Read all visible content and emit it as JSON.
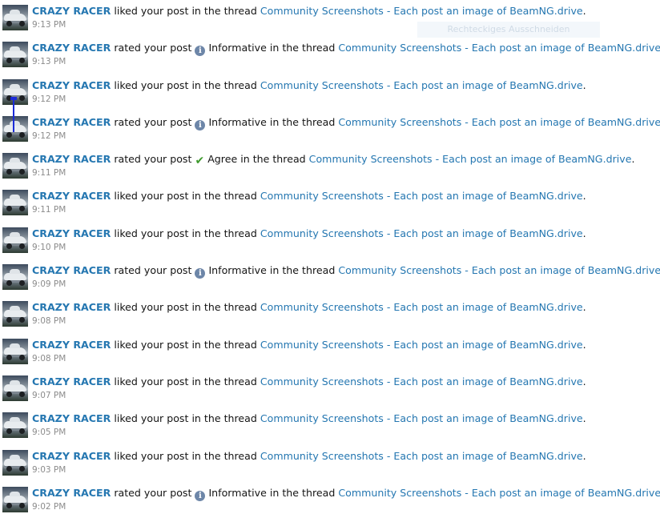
{
  "overlay": {
    "tooltip_text": "Rechteckiges Ausschneiden"
  },
  "alerts": [
    {
      "user": "CRAZY RACER",
      "action": "liked your post in the thread",
      "rating": "",
      "rating_icon": "",
      "suffix": "",
      "thread": "Community Screenshots - Each post an image of BeamNG.drive",
      "time": "9:13 PM"
    },
    {
      "user": "CRAZY RACER",
      "action": "rated your post",
      "rating": "Informative",
      "rating_icon": "info-icon",
      "suffix": "in the thread",
      "thread": "Community Screenshots - Each post an image of BeamNG.drive",
      "time": "9:13 PM"
    },
    {
      "user": "CRAZY RACER",
      "action": "liked your post in the thread",
      "rating": "",
      "rating_icon": "",
      "suffix": "",
      "thread": "Community Screenshots - Each post an image of BeamNG.drive",
      "time": "9:12 PM"
    },
    {
      "user": "CRAZY RACER",
      "action": "rated your post",
      "rating": "Informative",
      "rating_icon": "info-icon",
      "suffix": "in the thread",
      "thread": "Community Screenshots - Each post an image of BeamNG.drive",
      "time": "9:12 PM"
    },
    {
      "user": "CRAZY RACER",
      "action": "rated your post",
      "rating": "Agree",
      "rating_icon": "check-icon",
      "suffix": "in the thread",
      "thread": "Community Screenshots - Each post an image of BeamNG.drive",
      "time": "9:11 PM"
    },
    {
      "user": "CRAZY RACER",
      "action": "liked your post in the thread",
      "rating": "",
      "rating_icon": "",
      "suffix": "",
      "thread": "Community Screenshots - Each post an image of BeamNG.drive",
      "time": "9:11 PM"
    },
    {
      "user": "CRAZY RACER",
      "action": "liked your post in the thread",
      "rating": "",
      "rating_icon": "",
      "suffix": "",
      "thread": "Community Screenshots - Each post an image of BeamNG.drive",
      "time": "9:10 PM"
    },
    {
      "user": "CRAZY RACER",
      "action": "rated your post",
      "rating": "Informative",
      "rating_icon": "info-icon",
      "suffix": "in the thread",
      "thread": "Community Screenshots - Each post an image of BeamNG.drive",
      "time": "9:09 PM"
    },
    {
      "user": "CRAZY RACER",
      "action": "liked your post in the thread",
      "rating": "",
      "rating_icon": "",
      "suffix": "",
      "thread": "Community Screenshots - Each post an image of BeamNG.drive",
      "time": "9:08 PM"
    },
    {
      "user": "CRAZY RACER",
      "action": "liked your post in the thread",
      "rating": "",
      "rating_icon": "",
      "suffix": "",
      "thread": "Community Screenshots - Each post an image of BeamNG.drive",
      "time": "9:08 PM"
    },
    {
      "user": "CRAZY RACER",
      "action": "liked your post in the thread",
      "rating": "",
      "rating_icon": "",
      "suffix": "",
      "thread": "Community Screenshots - Each post an image of BeamNG.drive",
      "time": "9:07 PM"
    },
    {
      "user": "CRAZY RACER",
      "action": "liked your post in the thread",
      "rating": "",
      "rating_icon": "",
      "suffix": "",
      "thread": "Community Screenshots - Each post an image of BeamNG.drive",
      "time": "9:05 PM"
    },
    {
      "user": "CRAZY RACER",
      "action": "liked your post in the thread",
      "rating": "",
      "rating_icon": "",
      "suffix": "",
      "thread": "Community Screenshots - Each post an image of BeamNG.drive",
      "time": "9:03 PM"
    },
    {
      "user": "CRAZY RACER",
      "action": "rated your post",
      "rating": "Informative",
      "rating_icon": "info-icon",
      "suffix": "in the thread",
      "thread": "Community Screenshots - Each post an image of BeamNG.drive",
      "time": "9:02 PM"
    }
  ],
  "colors": {
    "link": "#2577b1",
    "text": "#141414",
    "time": "#8c8c8c",
    "informative_icon": "#6d86a8",
    "agree_icon": "#3e9a2d"
  }
}
